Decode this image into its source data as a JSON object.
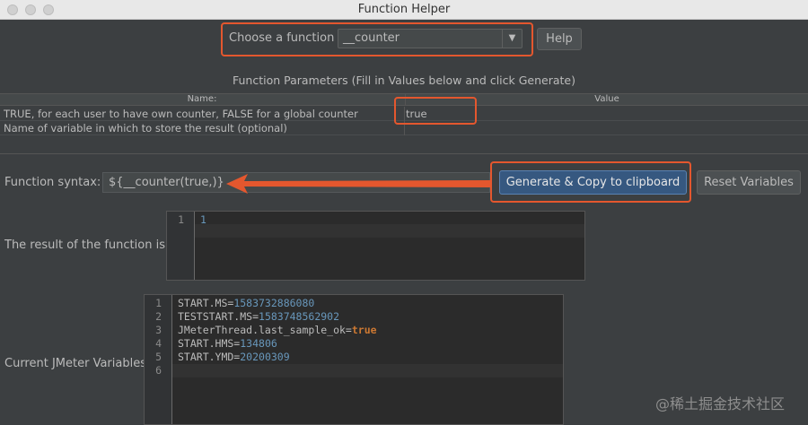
{
  "window": {
    "title": "Function Helper"
  },
  "chooser": {
    "label": "Choose a function",
    "selected": "__counter",
    "help_label": "Help"
  },
  "params": {
    "title": "Function Parameters (Fill in Values below and click Generate)",
    "headers": {
      "name": "Name:",
      "value": "Value"
    },
    "rows": [
      {
        "name": "TRUE, for each user to have own counter, FALSE for a global counter",
        "value": "true"
      },
      {
        "name": "Name of variable in which to store the result (optional)",
        "value": ""
      }
    ]
  },
  "syntax": {
    "label": "Function syntax:",
    "value": "${__counter(true,)}"
  },
  "buttons": {
    "generate": "Generate & Copy to clipboard",
    "reset": "Reset Variables"
  },
  "result": {
    "label": "The result of the function is",
    "lines": [
      "1"
    ],
    "line_numbers": [
      "1"
    ]
  },
  "vars": {
    "label": "Current JMeter Variables",
    "line_numbers": [
      "1",
      "2",
      "3",
      "4",
      "5",
      "6"
    ],
    "lines": [
      {
        "key": "START.MS=",
        "value": "1583732886080"
      },
      {
        "key": "TESTSTART.MS=",
        "value": "1583748562902"
      },
      {
        "key": "JMeterThread.last_sample_ok=",
        "value": "true"
      },
      {
        "key": "START.HMS=",
        "value": "134806"
      },
      {
        "key": "START.YMD=",
        "value": "20200309"
      },
      {
        "key": "",
        "value": ""
      }
    ]
  },
  "watermark": "@稀土掘金技术社区",
  "colors": {
    "highlight": "#e4572e",
    "primary_button": "#365880",
    "number": "#6897bb",
    "keyword": "#cc7832"
  }
}
